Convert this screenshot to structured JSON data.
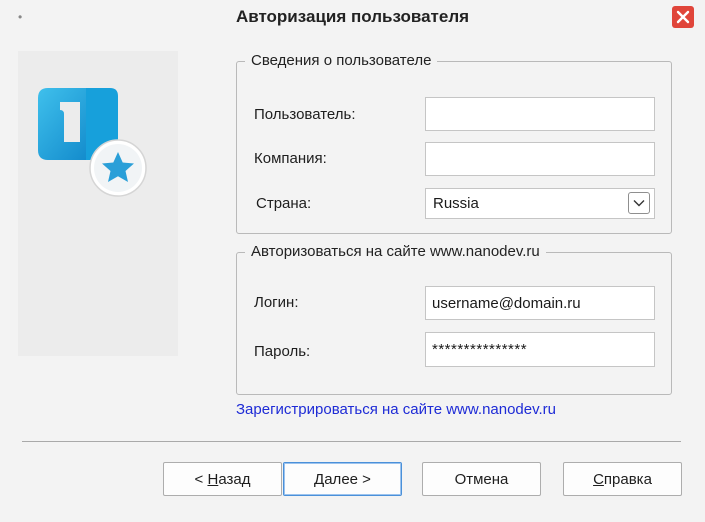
{
  "window": {
    "title": "Авторизация пользователя"
  },
  "user_info": {
    "legend": "Сведения о пользователе",
    "user_label": "Пользователь:",
    "user_value": "",
    "company_label": "Компания:",
    "company_value": "",
    "country_label": "Страна:",
    "country_value": "Russia"
  },
  "site_auth": {
    "legend": "Авторизоваться на сайте www.nanodev.ru",
    "login_label": "Логин:",
    "login_value": "username@domain.ru",
    "password_label": "Пароль:",
    "password_value": "***************"
  },
  "register_link": "Зарегистрироваться на сайте www.nanodev.ru",
  "buttons": {
    "back_prefix": "< ",
    "back_mnemonic": "Н",
    "back_rest": "азад",
    "next_mnemonic": "Д",
    "next_rest": "алее >",
    "cancel": "Отмена",
    "help_mnemonic": "С",
    "help_rest": "правка"
  },
  "colors": {
    "close_button": "#e0453a",
    "link": "#1e2bd6",
    "logo_primary": "#1aa3d9",
    "logo_star": "#2a9fd8"
  }
}
